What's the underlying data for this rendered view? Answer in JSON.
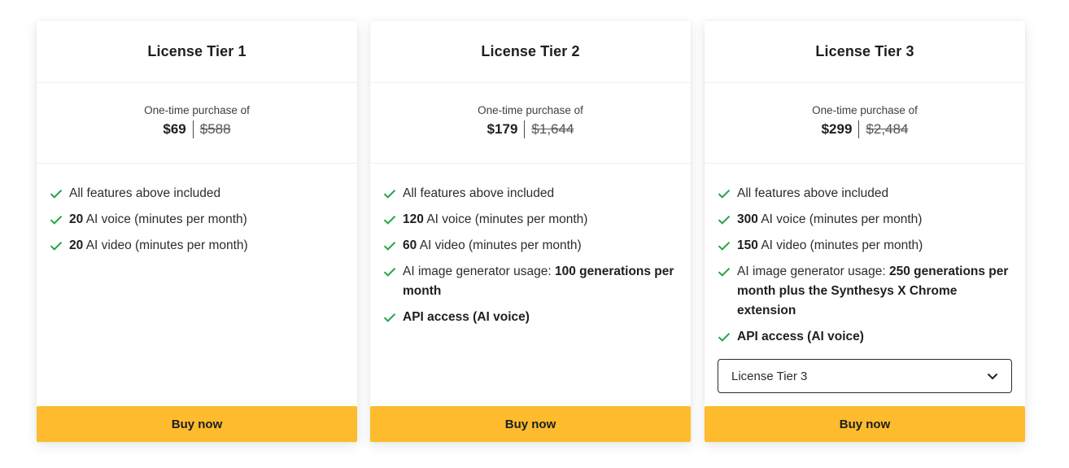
{
  "tiers": [
    {
      "title": "License Tier 1",
      "price_caption": "One-time purchase of",
      "price_now": "$69",
      "price_old": "$588",
      "features": [
        {
          "bold_prefix": "",
          "text": "All features above included",
          "bold_suffix": ""
        },
        {
          "bold_prefix": "20",
          "text": " AI voice (minutes per month)",
          "bold_suffix": ""
        },
        {
          "bold_prefix": "20",
          "text": " AI video (minutes per month)",
          "bold_suffix": ""
        }
      ],
      "buy_label": "Buy now"
    },
    {
      "title": "License Tier 2",
      "price_caption": "One-time purchase of",
      "price_now": "$179",
      "price_old": "$1,644",
      "features": [
        {
          "bold_prefix": "",
          "text": "All features above included",
          "bold_suffix": ""
        },
        {
          "bold_prefix": "120",
          "text": " AI voice (minutes per month)",
          "bold_suffix": ""
        },
        {
          "bold_prefix": "60",
          "text": " AI video (minutes per month)",
          "bold_suffix": ""
        },
        {
          "bold_prefix": "",
          "text": "AI image generator usage: ",
          "bold_suffix": "100 generations per month"
        },
        {
          "bold_prefix": "API access (AI voice)",
          "text": "",
          "bold_suffix": ""
        }
      ],
      "buy_label": "Buy now"
    },
    {
      "title": "License Tier 3",
      "price_caption": "One-time purchase of",
      "price_now": "$299",
      "price_old": "$2,484",
      "features": [
        {
          "bold_prefix": "",
          "text": "All features above included",
          "bold_suffix": ""
        },
        {
          "bold_prefix": "300",
          "text": " AI voice (minutes per month)",
          "bold_suffix": ""
        },
        {
          "bold_prefix": "150",
          "text": " AI video (minutes per month)",
          "bold_suffix": ""
        },
        {
          "bold_prefix": "",
          "text": "AI image generator usage: ",
          "bold_suffix": "250 generations per month plus the Synthesys X Chrome extension"
        },
        {
          "bold_prefix": "API access (AI voice)",
          "text": "",
          "bold_suffix": ""
        }
      ],
      "select_value": "License Tier 3",
      "buy_label": "Buy now"
    }
  ],
  "icons": {
    "feature_check": "check-icon",
    "select_arrow": "chevron-down-icon"
  },
  "colors": {
    "accent_button": "#fdbb2d",
    "check": "#22a447",
    "text": "#1c1f23"
  }
}
